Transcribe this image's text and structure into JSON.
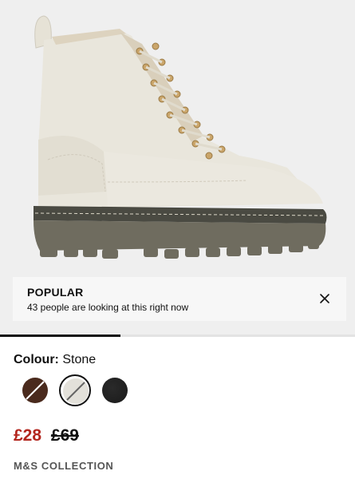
{
  "popular": {
    "title": "POPULAR",
    "text": "43 people are looking at this right now"
  },
  "gallery": {
    "progress_fraction": 0.34
  },
  "colour": {
    "label": "Colour:",
    "value": "Stone",
    "swatches": [
      {
        "name": "brown",
        "color": "#4a2a1d",
        "selected": false,
        "unavailable": true
      },
      {
        "name": "stone",
        "color": "#e3e1da",
        "selected": true,
        "unavailable": true
      },
      {
        "name": "black",
        "color": "#1a1a1a",
        "selected": false,
        "unavailable": false
      }
    ]
  },
  "price": {
    "current": "£28",
    "original": "£69",
    "current_color": "#b3261e"
  },
  "brand": "M&S COLLECTION",
  "icons": {
    "close": "close-icon"
  }
}
